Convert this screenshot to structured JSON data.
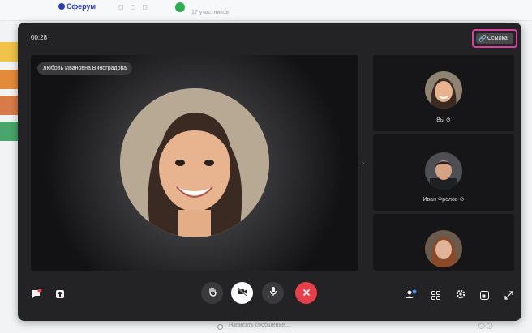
{
  "background": {
    "brand": "Сферум",
    "participants": "17 участников",
    "search_placeholder": "Написать сообщение..."
  },
  "call": {
    "timer": "00:28",
    "link_button": "Ссылка",
    "main_speaker": "Любовь Ивановна Виноградова",
    "side_tiles": [
      {
        "label": "Вы",
        "muted": true
      },
      {
        "label": "Иван Фролов",
        "muted": true
      },
      {
        "label": "",
        "muted": false
      }
    ]
  },
  "colors": {
    "modal_bg": "#232325",
    "tile_bg": "#161618",
    "highlight": "#d6409f",
    "end_call": "#e5404a",
    "camera_btn": "#ffffff"
  },
  "icons": {
    "left": [
      "chat-icon",
      "share-screen-icon"
    ],
    "center": [
      "raise-hand-icon",
      "camera-off-icon",
      "mic-icon",
      "end-call-icon"
    ],
    "right": [
      "participants-icon",
      "grid-icon",
      "settings-icon",
      "window-icon",
      "fullscreen-icon"
    ]
  }
}
